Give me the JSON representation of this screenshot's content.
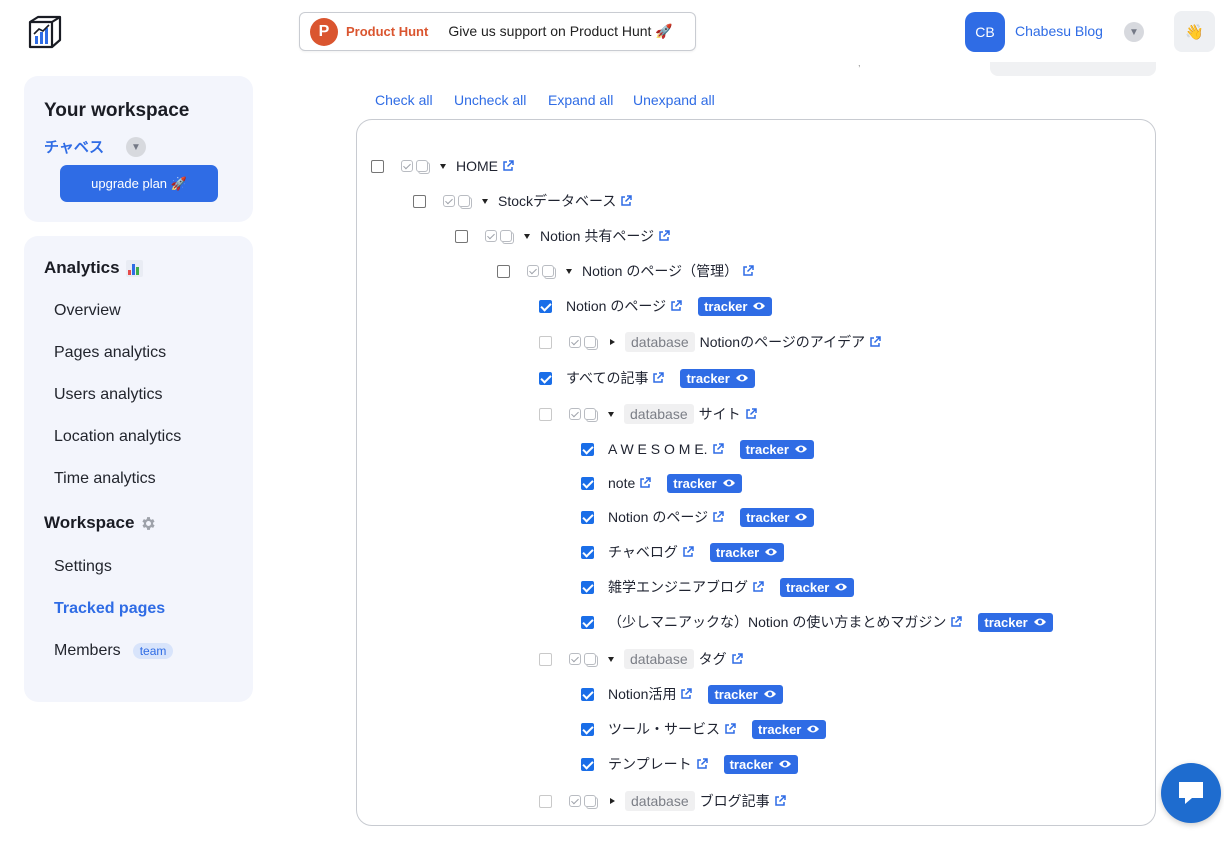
{
  "banner": {
    "brand": "Product Hunt",
    "brand_initial": "P",
    "text": "Give us support on Product Hunt 🚀"
  },
  "header": {
    "user_initials": "CB",
    "user_name": "Chabesu Blog",
    "wave_emoji": "👋"
  },
  "workspace": {
    "title": "Your workspace",
    "name": "チャベス",
    "upgrade_label": "upgrade plan 🚀"
  },
  "nav": {
    "analytics_heading": "Analytics",
    "analytics_items": [
      "Overview",
      "Pages analytics",
      "Users analytics",
      "Location analytics",
      "Time analytics"
    ],
    "workspace_heading": "Workspace",
    "workspace_items": [
      "Settings",
      "Tracked pages",
      "Members"
    ],
    "active_item": "Tracked pages",
    "members_badge": "team"
  },
  "toolbar": {
    "check_all": "Check all",
    "uncheck_all": "Uncheck all",
    "expand_all": "Expand all",
    "unexpand_all": "Unexpand all"
  },
  "tree": [
    {
      "label": "HOME",
      "level": 0,
      "checked": false,
      "faded": false,
      "expand": "down",
      "database": false,
      "tracker": false
    },
    {
      "label": "Stockデータベース",
      "level": 1,
      "checked": false,
      "faded": false,
      "expand": "down",
      "database": false,
      "tracker": false
    },
    {
      "label": "Notion 共有ページ",
      "level": 2,
      "checked": false,
      "faded": false,
      "expand": "down",
      "database": false,
      "tracker": false
    },
    {
      "label": "Notion のページ（管理）",
      "level": 3,
      "checked": false,
      "faded": false,
      "expand": "down",
      "database": false,
      "tracker": false
    },
    {
      "label": "Notion のページ",
      "level": 4,
      "checked": true,
      "faded": false,
      "expand": "none",
      "database": false,
      "tracker": true
    },
    {
      "label": "Notionのページのアイデア",
      "level": 4,
      "checked": false,
      "faded": true,
      "expand": "right",
      "database": true,
      "tracker": false
    },
    {
      "label": "すべての記事",
      "level": 4,
      "checked": true,
      "faded": false,
      "expand": "none",
      "database": false,
      "tracker": true
    },
    {
      "label": "サイト",
      "level": 4,
      "checked": false,
      "faded": true,
      "expand": "down",
      "database": true,
      "tracker": false
    },
    {
      "label": "A W E S O M E.",
      "level": 5,
      "checked": true,
      "faded": false,
      "expand": "none",
      "database": false,
      "tracker": true
    },
    {
      "label": "note",
      "level": 5,
      "checked": true,
      "faded": false,
      "expand": "none",
      "database": false,
      "tracker": true
    },
    {
      "label": "Notion のページ",
      "level": 5,
      "checked": true,
      "faded": false,
      "expand": "none",
      "database": false,
      "tracker": true
    },
    {
      "label": "チャベログ",
      "level": 5,
      "checked": true,
      "faded": false,
      "expand": "none",
      "database": false,
      "tracker": true
    },
    {
      "label": "雑学エンジニアブログ",
      "level": 5,
      "checked": true,
      "faded": false,
      "expand": "none",
      "database": false,
      "tracker": true
    },
    {
      "label": "（少しマニアックな）Notion の使い方まとめマガジン",
      "level": 5,
      "checked": true,
      "faded": false,
      "expand": "none",
      "database": false,
      "tracker": true
    },
    {
      "label": "タグ",
      "level": 4,
      "checked": false,
      "faded": true,
      "expand": "down",
      "database": true,
      "tracker": false
    },
    {
      "label": "Notion活用",
      "level": 5,
      "checked": true,
      "faded": false,
      "expand": "none",
      "database": false,
      "tracker": true
    },
    {
      "label": "ツール・サービス",
      "level": 5,
      "checked": true,
      "faded": false,
      "expand": "none",
      "database": false,
      "tracker": true
    },
    {
      "label": "テンプレート",
      "level": 5,
      "checked": true,
      "faded": false,
      "expand": "none",
      "database": false,
      "tracker": true
    },
    {
      "label": "ブログ記事",
      "level": 4,
      "checked": false,
      "faded": true,
      "expand": "right",
      "database": true,
      "tracker": false
    }
  ],
  "tags": {
    "database": "database",
    "tracker": "tracker"
  },
  "colors": {
    "accent": "#2f6ce5",
    "brand_orange": "#da552f",
    "chat": "#1e6ccf"
  }
}
